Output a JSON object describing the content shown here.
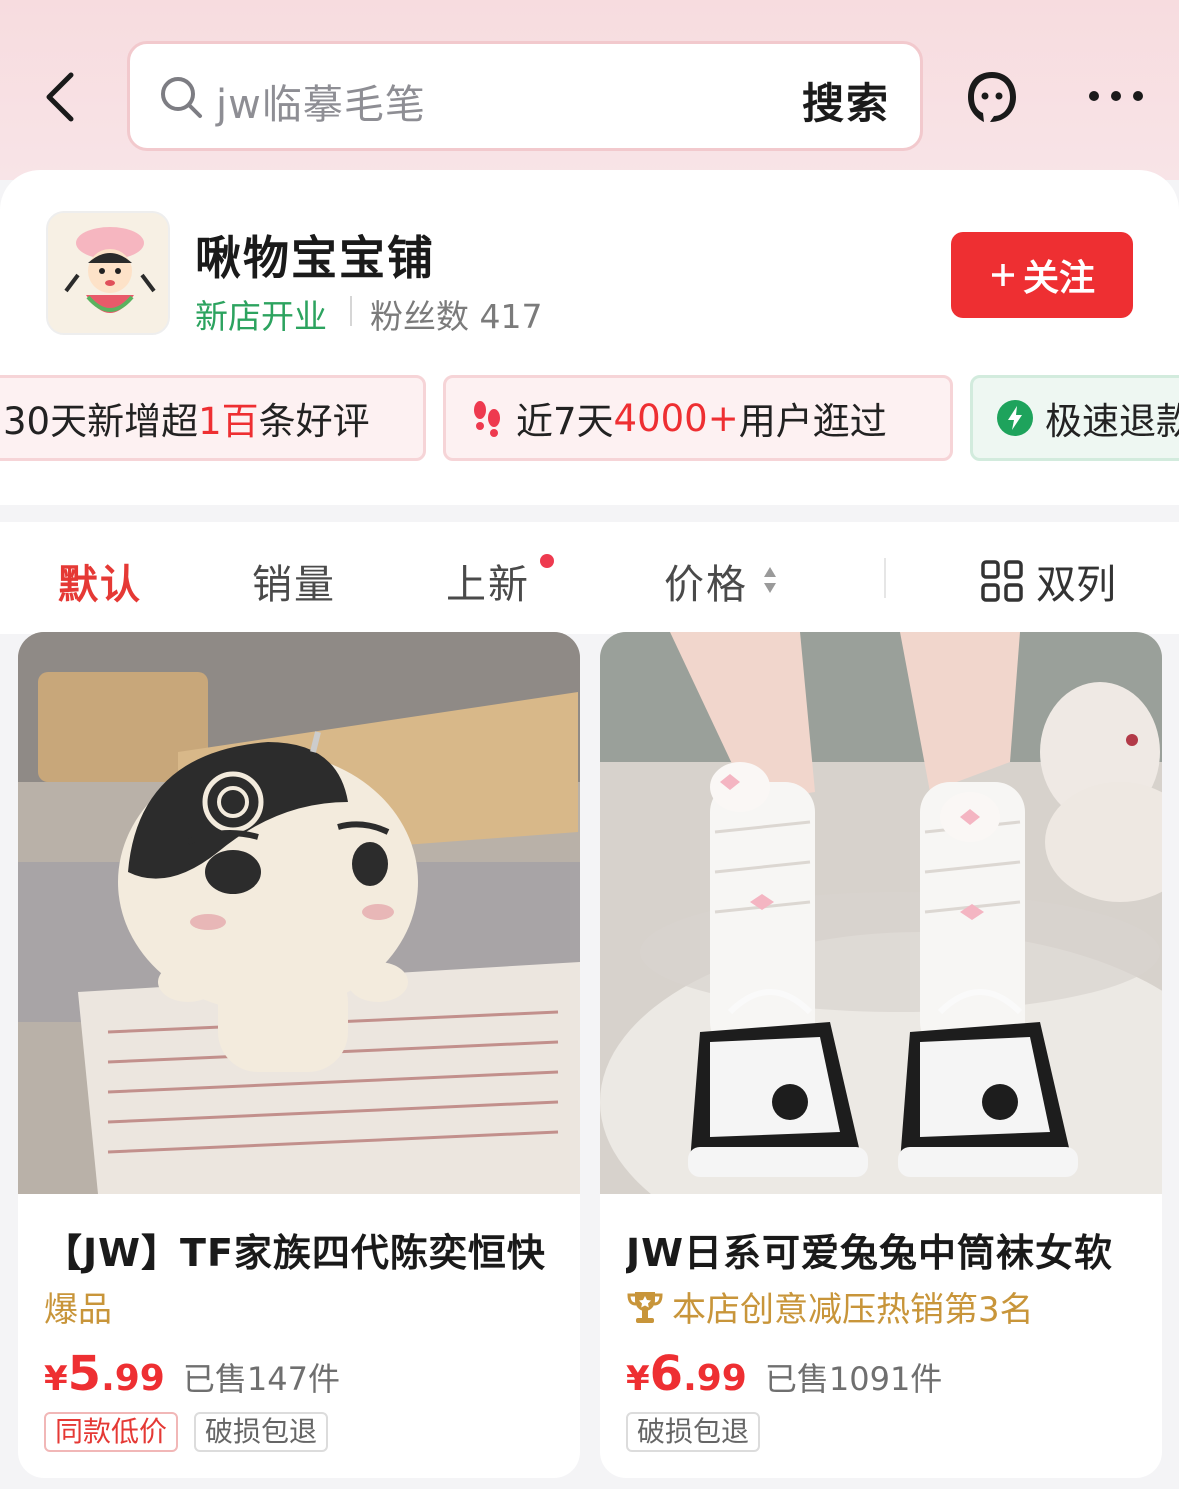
{
  "search": {
    "query": "jw临摹毛笔",
    "button_label": "搜索"
  },
  "shop": {
    "name": "啾物宝宝铺",
    "tag": "新店开业",
    "fans_label": "粉丝数",
    "fans_count": "417",
    "follow_label": "关注"
  },
  "badges": [
    {
      "pre": "30天新增超",
      "hl": "1百",
      "post": "条好评"
    },
    {
      "pre": "近7天",
      "hl": "4000+",
      "post": "用户逛过"
    },
    {
      "pre": "",
      "hl": "",
      "post": "极速退款"
    }
  ],
  "sort": {
    "default": "默认",
    "sales": "销量",
    "new": "上新",
    "price": "价格",
    "layout": "双列"
  },
  "products": [
    {
      "title": "【JW】TF家族四代陈奕恒快",
      "sub": "爆品",
      "price_symbol": "¥",
      "price_int": "5",
      "price_dec": ".99",
      "sold": "已售147件",
      "tags": [
        "同款低价",
        "破损包退"
      ]
    },
    {
      "title": "JW日系可爱兔兔中筒袜女软",
      "sub": "本店创意减压热销第3名",
      "price_symbol": "¥",
      "price_int": "6",
      "price_dec": ".99",
      "sold": "已售1091件",
      "tags": [
        "破损包退"
      ]
    }
  ],
  "colors": {
    "accent_red": "#ee2f32",
    "shop_tag_green": "#2ca35f",
    "sub_gold": "#c8953a"
  }
}
